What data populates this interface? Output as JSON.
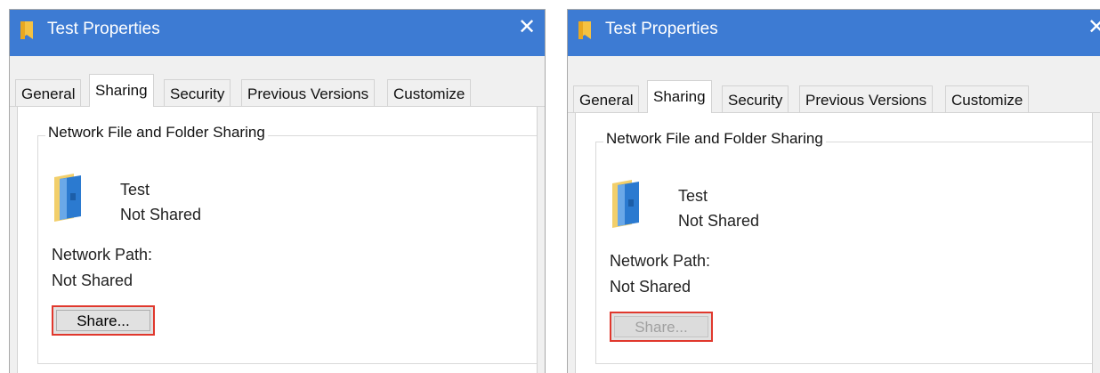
{
  "dialogs": [
    {
      "title": "Test Properties",
      "close_glyph": "✕",
      "tabs": [
        "General",
        "Sharing",
        "Security",
        "Previous Versions",
        "Customize"
      ],
      "active_tab": "Sharing",
      "group_title": "Network File and Folder Sharing",
      "folder_name": "Test",
      "folder_status": "Not Shared",
      "network_path_label": "Network Path:",
      "network_path_value": "Not Shared",
      "share_button_label": "Share...",
      "share_button_enabled": true
    },
    {
      "title": "Test Properties",
      "close_glyph": "✕",
      "tabs": [
        "General",
        "Sharing",
        "Security",
        "Previous Versions",
        "Customize"
      ],
      "active_tab": "Sharing",
      "group_title": "Network File and Folder Sharing",
      "folder_name": "Test",
      "folder_status": "Not Shared",
      "network_path_label": "Network Path:",
      "network_path_value": "Not Shared",
      "share_button_label": "Share...",
      "share_button_enabled": false
    }
  ],
  "icons": {
    "title_icon": "folder-title-icon",
    "folder_icon": "shared-folder-icon"
  },
  "colors": {
    "titlebar": "#3d7bd3",
    "highlight_border": "#e0382d"
  }
}
